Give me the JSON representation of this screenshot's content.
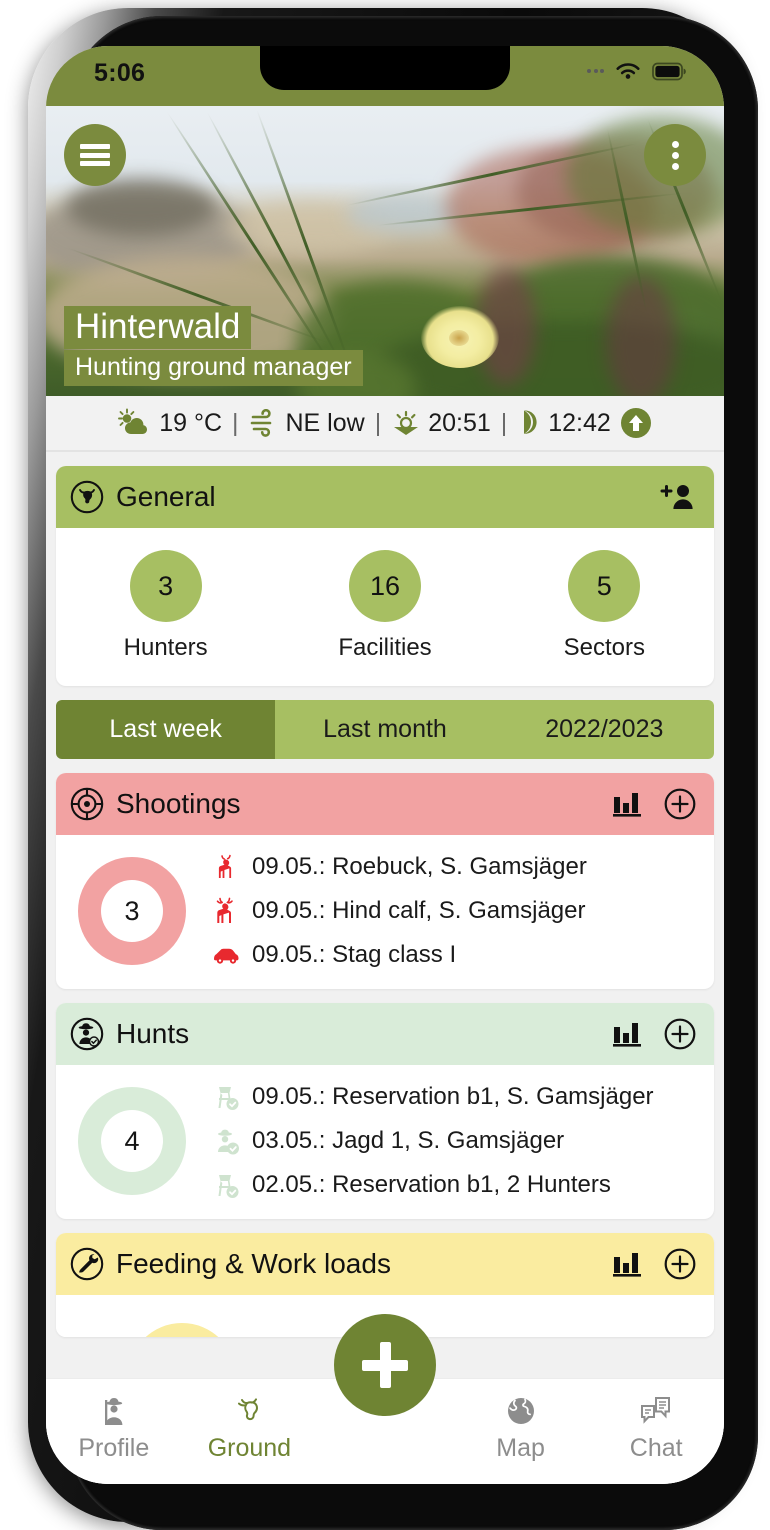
{
  "status_bar": {
    "time": "5:06",
    "wifi_icon": "wifi-icon",
    "battery_icon": "battery-full-icon",
    "signal_icon": "signal-dots-icon"
  },
  "hero": {
    "title": "Hinterwald",
    "subtitle": "Hunting ground manager",
    "menu_icon": "hamburger-menu-icon",
    "overflow_icon": "more-vertical-icon"
  },
  "weather": {
    "temperature": "19 °C",
    "wind": "NE low",
    "sunset": "20:51",
    "moon": "12:42",
    "separator": "|",
    "temp_icon": "sun-cloud-icon",
    "wind_icon": "wind-icon",
    "sun_icon": "sunset-icon",
    "moon_icon": "moon-icon",
    "arrow_icon": "arrow-up-circle-icon"
  },
  "general": {
    "title": "General",
    "icon": "deer-head-circle-icon",
    "add_icon": "add-person-icon",
    "stats": [
      {
        "value": "3",
        "label": "Hunters"
      },
      {
        "value": "16",
        "label": "Facilities"
      },
      {
        "value": "5",
        "label": "Sectors"
      }
    ]
  },
  "segmented": {
    "options": [
      {
        "label": "Last week",
        "active": true
      },
      {
        "label": "Last month",
        "active": false
      },
      {
        "label": "2022/2023",
        "active": false
      }
    ]
  },
  "shootings": {
    "title": "Shootings",
    "icon": "crosshair-icon",
    "chart_icon": "bar-chart-icon",
    "add_icon": "plus-circle-icon",
    "count": "3",
    "entries": [
      {
        "icon": "roe-deer-icon",
        "text": "09.05.: Roebuck, S. Gamsjäger"
      },
      {
        "icon": "red-deer-icon",
        "text": "09.05.: Hind calf, S. Gamsjäger"
      },
      {
        "icon": "car-icon",
        "text": "09.05.: Stag class I"
      }
    ]
  },
  "hunts": {
    "title": "Hunts",
    "icon": "hunter-check-circle-icon",
    "chart_icon": "bar-chart-icon",
    "add_icon": "plus-circle-icon",
    "count": "4",
    "entries": [
      {
        "icon": "high-seat-check-icon",
        "text": "09.05.: Reservation b1, S. Gamsjäger"
      },
      {
        "icon": "hunter-check-icon",
        "text": "03.05.: Jagd 1, S. Gamsjäger"
      },
      {
        "icon": "high-seat-check-icon",
        "text": "02.05.: Reservation b1, 2 Hunters"
      }
    ]
  },
  "feeding": {
    "title": "Feeding & Work loads",
    "icon": "wrench-circle-icon",
    "chart_icon": "bar-chart-icon",
    "add_icon": "plus-circle-icon"
  },
  "fab": {
    "icon": "plus-icon"
  },
  "bottom_nav": {
    "items": [
      {
        "label": "Profile",
        "icon": "hunter-icon",
        "active": false
      },
      {
        "label": "Ground",
        "icon": "deer-head-icon",
        "active": true
      },
      {
        "label": "Map",
        "icon": "globe-icon",
        "active": false
      },
      {
        "label": "Chat",
        "icon": "chat-icon",
        "active": false
      }
    ]
  },
  "colors": {
    "brand_dark": "#6f8433",
    "brand": "#7b8b3e",
    "brand_light": "#a7bf62",
    "shootings": "#f2a2a2",
    "hunts": "#d9ecd9",
    "feeding": "#faeca0",
    "accent_red": "#e8292f"
  }
}
